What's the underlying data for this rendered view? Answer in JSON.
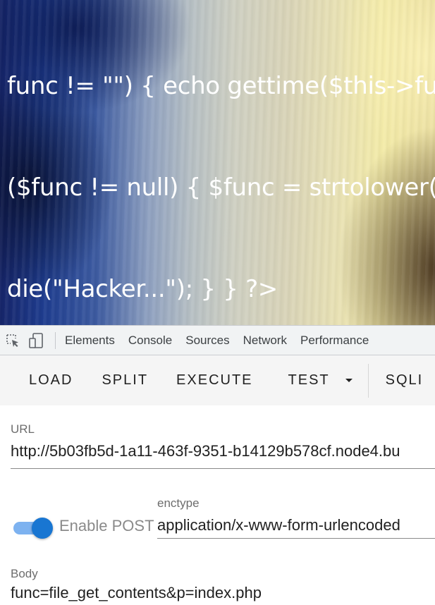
{
  "page_view": {
    "code_lines": [
      "func != \"\") { echo gettime($this->fu",
      "($func != null) { $func = strtolower(",
      "die(\"Hacker...\"); } } ?>"
    ]
  },
  "devtools": {
    "icons": [
      "inspect-element-icon",
      "device-toolbar-icon"
    ],
    "tabs": [
      "Elements",
      "Console",
      "Sources",
      "Network",
      "Performance"
    ]
  },
  "hackbar": {
    "toolbar": {
      "load": "LOAD",
      "split": "SPLIT",
      "execute": "EXECUTE",
      "test": "TEST",
      "sqli": "SQLI"
    },
    "url": {
      "label": "URL",
      "value": "http://5b03fb5d-1a11-463f-9351-b14129b578cf.node4.bu"
    },
    "enctype": {
      "label": "enctype",
      "value": "application/x-www-form-urlencoded"
    },
    "post_toggle": {
      "label": "Enable POST",
      "enabled": true
    },
    "body": {
      "label": "Body",
      "value": "func=file_get_contents&p=index.php"
    }
  },
  "colors": {
    "accent": "#1976d2",
    "toggle_track": "#7db2f0"
  }
}
